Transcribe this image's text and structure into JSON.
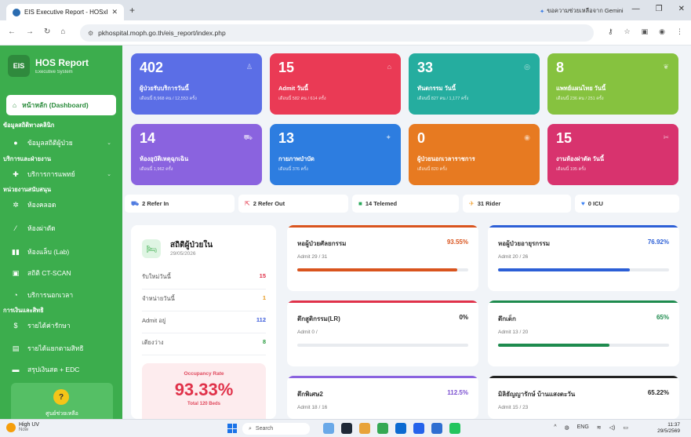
{
  "browser": {
    "tab_title": "EIS Executive Report - HOSxP",
    "new_tab": "+",
    "gemini": "ขอความช่วยเหลือจาก Gemini",
    "url": "pkhospital.moph.go.th/eis_report/index.php"
  },
  "sidebar": {
    "logo": "EIS",
    "brand_title": "HOS Report",
    "brand_sub": "Executive System",
    "active_item": "หน้าหลัก (Dashboard)",
    "section_patient": "ข้อมูลสถิติทางคลินิก",
    "item_patient": "ข้อมูลสถิติผู้ป่วย",
    "section_service": "บริการและฝ่ายงาน",
    "item_service": "บริการการแพทย์",
    "section_support": "หน่วยงานสนับสนุน",
    "item_labor": "ห้องคลอด",
    "item_or": "ห้องผ่าตัด",
    "item_lab": "ห้องแล็บ (Lab)",
    "item_ct": "สถิติ CT-SCAN",
    "item_overtime": "บริการนอกเวลา",
    "section_finance": "การเงินและสิทธิ",
    "item_income": "รายได้ค่ารักษา",
    "item_income_right": "รายได้แยกตามสิทธิ",
    "item_summary": "สรุปเงินสด + EDC",
    "help_icon": "?",
    "help_text": "ศูนย์ช่วยเหลือ"
  },
  "tiles": [
    {
      "value": "402",
      "label": "ผู้ป่วยรับบริการวันนี้",
      "sub": "เดือนนี้ 8,968 คน / 12,553 ครั้ง",
      "color": "#5b6ee6"
    },
    {
      "value": "15",
      "label": "Admit วันนี้",
      "sub": "เดือนนี้ 582 คน / 614 ครั้ง",
      "color": "#ea3a55"
    },
    {
      "value": "33",
      "label": "ทันตกรรม วันนี้",
      "sub": "เดือนนี้ 827 คน / 1,177 ครั้ง",
      "color": "#25ad9f"
    },
    {
      "value": "8",
      "label": "แพทย์แผนไทย วันนี้",
      "sub": "เดือนนี้ 236 คน / 251 ครั้ง",
      "color": "#86c23f"
    },
    {
      "value": "14",
      "label": "ห้องอุบัติเหตุฉุกเฉิน",
      "sub": "เดือนนี้ 1,962 ครั้ง",
      "color": "#8a63df"
    },
    {
      "value": "13",
      "label": "กายภาพบำบัด",
      "sub": "เดือนนี้ 376 ครั้ง",
      "color": "#2d7de0"
    },
    {
      "value": "0",
      "label": "ผู้ป่วยนอกเวลาราชการ",
      "sub": "เดือนนี้ 820 ครั้ง",
      "color": "#e77a21"
    },
    {
      "value": "15",
      "label": "งานห้องผ่าตัด วันนี้",
      "sub": "เดือนนี้ 195 ครั้ง",
      "color": "#d8336e"
    }
  ],
  "chips": [
    {
      "icon": "⛟",
      "label": "2 Refer In",
      "color": "#4f7be0"
    },
    {
      "icon": "⇱",
      "label": "2 Refer Out",
      "color": "#e85b6b"
    },
    {
      "icon": "■",
      "label": "14 Telemed",
      "color": "#28a85a"
    },
    {
      "icon": "✈",
      "label": "31 Rider",
      "color": "#f0a030"
    },
    {
      "icon": "♥",
      "label": "0 ICU",
      "color": "#3b82f6"
    }
  ],
  "inpatient": {
    "title": "สถิติผู้ป่วยใน",
    "date": "29/05/2026",
    "rows": [
      {
        "label": "รับใหม่วันนี้",
        "value": "15",
        "color": "#e0324a"
      },
      {
        "label": "จำหน่ายวันนี้",
        "value": "1",
        "color": "#e79a20"
      },
      {
        "label": "Admit อยู่",
        "value": "112",
        "color": "#3b5bdb"
      },
      {
        "label": "เตียงว่าง",
        "value": "8",
        "color": "#2f9e44"
      }
    ],
    "occ_title": "Occupancy Rate",
    "occ_value": "93.33%",
    "occ_sub": "Total 120 Beds"
  },
  "wards": [
    {
      "name": "หอผู้ป่วยศัลยกรรม",
      "percent": "93.55%",
      "admit": "Admit 29 / 31",
      "fill": 0.9355,
      "color": "#d9541e",
      "pct_color": "#d9541e"
    },
    {
      "name": "หอผู้ป่วยอายุรกรรม",
      "percent": "76.92%",
      "admit": "Admit 20 / 26",
      "fill": 0.7692,
      "color": "#2c5fd6",
      "pct_color": "#2c5fd6"
    },
    {
      "name": "ตึกสูติกรรม(LR)",
      "percent": "0%",
      "admit": "Admit 0 /",
      "fill": 0,
      "color": "#e0324a",
      "pct_color": "#222"
    },
    {
      "name": "ตึกเด็ก",
      "percent": "65%",
      "admit": "Admit 13 / 20",
      "fill": 0.65,
      "color": "#1e8b4e",
      "pct_color": "#1e8b4e"
    },
    {
      "name": "ตึกพิเศษ2",
      "percent": "112.5%",
      "admit": "Admit 18 / 16",
      "fill": 1.0,
      "color": "#8a63df",
      "pct_color": "#7a4fd0"
    },
    {
      "name": "มิลิธัญญารักษ์ บ้านแสงตะวัน",
      "percent": "65.22%",
      "admit": "Admit 15 / 23",
      "fill": 0.6522,
      "color": "#222",
      "pct_color": "#222"
    }
  ],
  "taskbar": {
    "weather_title": "High UV",
    "weather_sub": "Now",
    "search": "Search",
    "lang": "ENG",
    "time": "11:37",
    "date": "29/5/2569"
  }
}
